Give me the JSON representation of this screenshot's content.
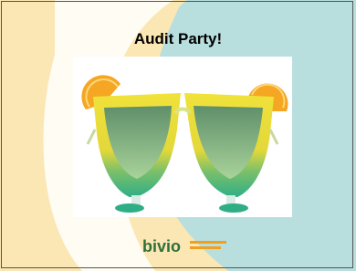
{
  "slide": {
    "title": "Audit Party!",
    "image_subject": "novelty cocktail-glass party sunglasses",
    "logo_text": "bivio",
    "logo_tagline_lines": [
      "",
      ""
    ]
  },
  "colors": {
    "cream": "#fbe7b4",
    "teal": "#b9dede",
    "lemon": "#f5a623",
    "frame_yellow": "#e9e23a",
    "frame_green": "#36b27c",
    "lens": "#7fb98c",
    "logo_green": "#2f6f3a",
    "logo_orange": "#f0a020"
  },
  "icons": [
    "lemon-slice-icon",
    "party-glasses-icon",
    "bivio-logo-icon"
  ]
}
